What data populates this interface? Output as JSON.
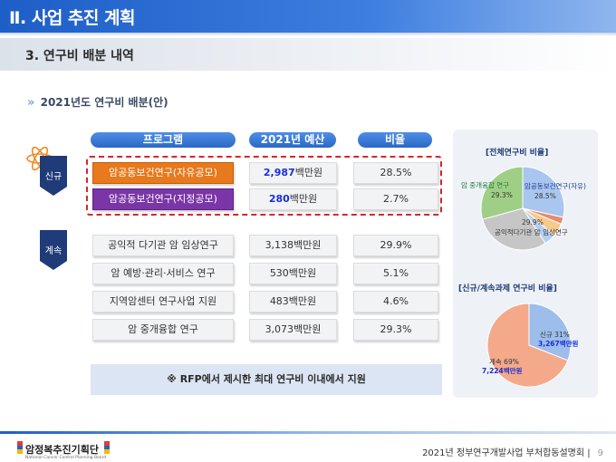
{
  "header": {
    "title": "Ⅱ. 사업 추진 계획"
  },
  "subheader": {
    "title": "3. 연구비 배분 내역"
  },
  "section": {
    "arrows": "»",
    "title": "2021년도 연구비 배분(안)"
  },
  "table": {
    "columns": [
      "프로그램",
      "2021년 예산",
      "비율"
    ],
    "groups": [
      {
        "label": "신규"
      },
      {
        "label": "계속"
      }
    ],
    "new_rows": [
      {
        "program": "암공동보건연구(자유공모)",
        "budget_num": "2,987",
        "budget_unit": "백만원",
        "ratio": "28.5%"
      },
      {
        "program": "암공동보건연구(지정공모)",
        "budget_num": "280",
        "budget_unit": "백만원",
        "ratio": "2.7%"
      }
    ],
    "cont_rows": [
      {
        "program": "공익적 다기관 암 임상연구",
        "budget": "3,138백만원",
        "ratio": "29.9%"
      },
      {
        "program": "암 예방·관리·서비스 연구",
        "budget": "530백만원",
        "ratio": "5.1%"
      },
      {
        "program": "지역암센터 연구사업 지원",
        "budget": "483백만원",
        "ratio": "4.6%"
      },
      {
        "program": "암 중개융합 연구",
        "budget": "3,073백만원",
        "ratio": "29.3%"
      }
    ]
  },
  "note": "※ RFP에서 제시한 최대 연구비 이내에서 지원",
  "chart_data": [
    {
      "type": "pie",
      "title": "[전체연구비 비율]",
      "slices": [
        {
          "name": "암공동보건연구(자유)",
          "value": 28.5,
          "color": "#a9c6ee"
        },
        {
          "name": "",
          "value": 2.7,
          "color": "#e98a6c"
        },
        {
          "name": "",
          "value": 5.1,
          "color": "#f6c98c"
        },
        {
          "name": "",
          "value": 4.6,
          "color": "#b7cfee"
        },
        {
          "name": "공익적다기관 암 임상연구",
          "value": 29.9,
          "color": "#c6c6c6"
        },
        {
          "name": "암 중개융합 연구",
          "value": 29.3,
          "color": "#9fcf86"
        }
      ],
      "labels": {
        "jayu": "암공동보건연구(자유)",
        "jayu_pct": "28.5%",
        "junggae": "암 중개융합 연구",
        "junggae_pct": "29.3%",
        "gongik_pct": "29.9%",
        "gongik": "공익적다기관 암 임상연구"
      }
    },
    {
      "type": "pie",
      "title": "[신규/계속과제 연구비 비율]",
      "slices": [
        {
          "name": "신규",
          "value": 31,
          "color": "#9dbdeb"
        },
        {
          "name": "계속",
          "value": 69,
          "color": "#f4a98b"
        }
      ],
      "labels": {
        "sinkyu": "신규 31%",
        "sinkyu_amt": "3,267백만원",
        "gyesok": "계속 69%",
        "gyesok_amt": "7,224백만원"
      }
    }
  ],
  "footer": {
    "logo": "암정복추진기획단",
    "logo_sub": "National Cancer Control Planning Board",
    "text": "2021년 정부연구개발사업 부처합동설명회 |",
    "page": "9"
  }
}
